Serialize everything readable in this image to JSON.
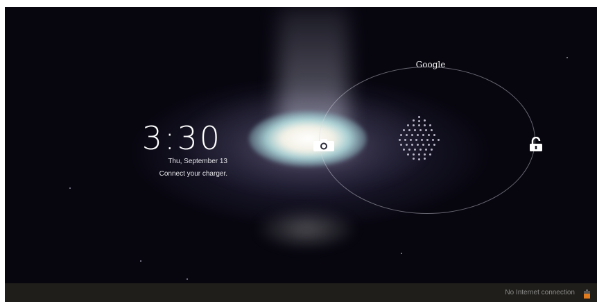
{
  "lockscreen": {
    "time": "3:30",
    "date": "Thu, September 13",
    "charger_message": "Connect your charger."
  },
  "unlock_ring": {
    "top_target_label": "Google",
    "left_target_icon": "camera-icon",
    "right_target_icon": "unlock-icon",
    "center_handle_icon": "dotted-handle-icon"
  },
  "status_bar": {
    "connection_text": "No Internet connection",
    "battery_icon": "battery-icon",
    "battery_color": "#e07b1f"
  }
}
